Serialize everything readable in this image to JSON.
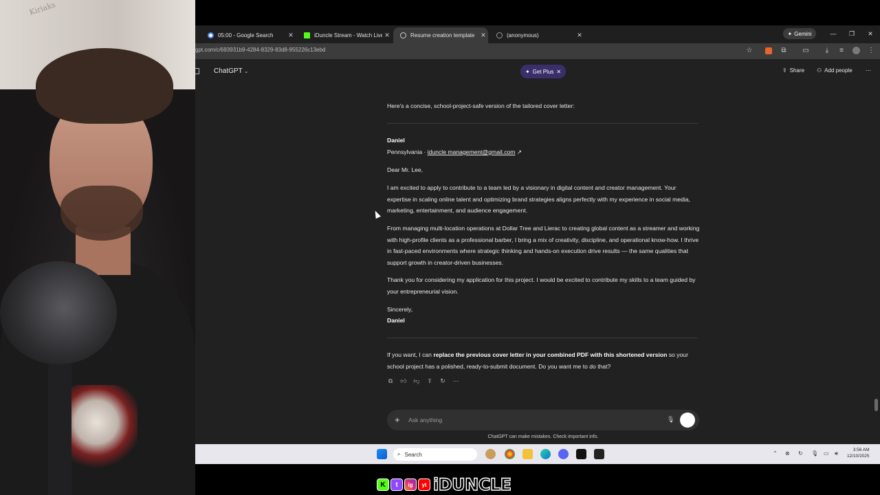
{
  "browser": {
    "tabs": [
      {
        "title": "05:00 - Google Search",
        "favicon_color": "#ffffff"
      },
      {
        "title": "iDuncle Stream - Watch Live on",
        "favicon_color": "#53fc18"
      },
      {
        "title": "Resume creation template",
        "favicon_color": "#d0d0d0"
      },
      {
        "title": "(anonymous)",
        "favicon_color": "#9a9a9a"
      }
    ],
    "active_tab_index": 2,
    "gemini_label": "Gemini",
    "url": "gpt.com/c/693931b9-4284-8329-83d8-955226c13ebd"
  },
  "chatgpt": {
    "model_label": "ChatGPT",
    "get_plus_label": "Get Plus",
    "share_label": "Share",
    "add_people_label": "Add people"
  },
  "message": {
    "intro": "Here's a concise, school-project-safe version of the tailored cover letter:",
    "sender_name": "Daniel",
    "location": "Pennsylvania · ",
    "email": "iduncle management@gmail.com",
    "salutation": "Dear Mr. Lee,",
    "para1": "I am excited to apply to contribute to a team led by a visionary in digital content and creator management. Your expertise in scaling online talent and optimizing brand strategies aligns perfectly with my experience in social media, marketing, entertainment, and audience engagement.",
    "para2": "From managing multi-location operations at Dollar Tree and Lierac to creating global content as a streamer and working with high-profile clients as a professional barber, I bring a mix of creativity, discipline, and operational know-how. I thrive in fast-paced environments where strategic thinking and hands-on execution drive results — the same qualities that support growth in creator-driven businesses.",
    "para3": "Thank you for considering my application for this project. I would be excited to contribute my skills to a team guided by your entrepreneurial vision.",
    "closing": "Sincerely,",
    "closing_name": "Daniel",
    "followup_pre": "If you want, I can ",
    "followup_bold": "replace the previous cover letter in your combined PDF with this shortened version",
    "followup_post": " so your school project has a polished, ready-to-submit document. Do you want me to do that?"
  },
  "composer": {
    "placeholder": "Ask anything",
    "disclaimer": "ChatGPT can make mistakes. Check important info."
  },
  "taskbar": {
    "search_label": "Search",
    "time": "3:56 AM",
    "date": "12/10/2025"
  },
  "stream": {
    "webcam_wall_text": "Kiriaks",
    "brand_text": "iDUNCLE",
    "socials": [
      "K",
      "t",
      "ig",
      "yt"
    ]
  }
}
